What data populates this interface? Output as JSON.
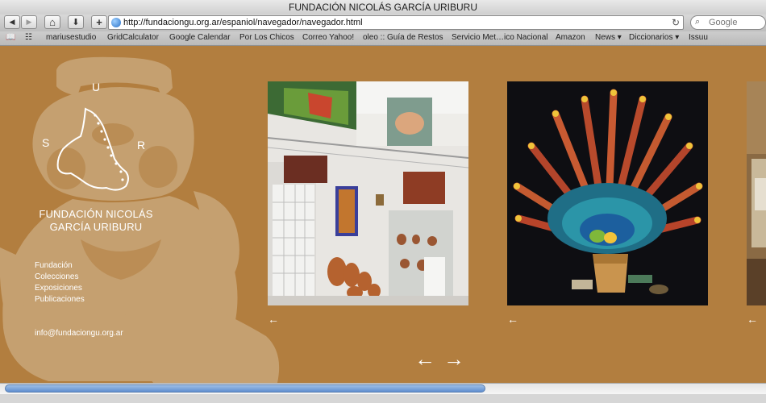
{
  "window": {
    "title": "FUNDACIÓN NICOLÁS GARCÍA URIBURU"
  },
  "toolbar": {
    "back": "◀",
    "forward": "▶",
    "home": "⌂",
    "download": "⬇",
    "add": "+",
    "url": "http://fundaciongu.org.ar/espaniol/navegador/navegador.html",
    "reload": "↻",
    "search_placeholder": "Google",
    "search_icon": "⌕"
  },
  "bookmarks": {
    "book_icon": "📖",
    "grid_icon": "☷",
    "items": [
      "mariusestudio",
      "GridCalculator",
      "Google Calendar",
      "Por Los Chicos",
      "Correo Yahoo!",
      "oleo :: Guía de Restos",
      "Servicio Met…ico Nacional",
      "Amazon",
      "News ▾",
      "Diccionarios ▾",
      "Issuu"
    ]
  },
  "logo": {
    "letter_s": "S",
    "letter_u": "U",
    "letter_r": "R"
  },
  "brand": {
    "line1": "FUNDACIÓN NICOLÁS",
    "line2": "GARCÍA URIBURU"
  },
  "nav": {
    "items": [
      "Fundación",
      "Colecciones",
      "Exposiciones",
      "Publicaciones"
    ]
  },
  "contact": {
    "email": "info@fundaciongu.org.ar"
  },
  "gallery": {
    "prev_small": "←",
    "prev": "←",
    "next": "→"
  },
  "colors": {
    "background": "#b27e3f",
    "text": "#ffffff"
  }
}
